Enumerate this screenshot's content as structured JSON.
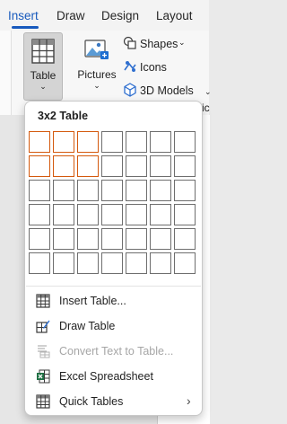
{
  "ribbon": {
    "tabs": [
      {
        "label": "Insert",
        "active": true
      },
      {
        "label": "Draw",
        "active": false
      },
      {
        "label": "Design",
        "active": false
      },
      {
        "label": "Layout",
        "active": false
      }
    ],
    "table_button": {
      "label": "Table"
    },
    "pictures_button": {
      "label": "Pictures"
    },
    "shapes_button": {
      "label": "Shapes"
    },
    "icons_button": {
      "label": "Icons"
    },
    "models_button": {
      "label": "3D Models"
    },
    "cutoff_text": "ic"
  },
  "table_menu": {
    "grid_title": "3x2 Table",
    "grid": {
      "columns": 7,
      "rows": 6,
      "selected_columns": 3,
      "selected_rows": 2
    },
    "items": [
      {
        "label": "Insert Table...",
        "icon": "insert-table-icon",
        "enabled": true
      },
      {
        "label": "Draw Table",
        "icon": "draw-table-icon",
        "enabled": true
      },
      {
        "label": "Convert Text to Table...",
        "icon": "convert-text-icon",
        "enabled": false
      },
      {
        "label": "Excel Spreadsheet",
        "icon": "excel-icon",
        "enabled": true
      },
      {
        "label": "Quick Tables",
        "icon": "quick-tables-icon",
        "enabled": true,
        "submenu": true
      }
    ]
  },
  "colors": {
    "accent": "#185abd",
    "selection": "#d4590d",
    "excel_green": "#1d6f42"
  }
}
